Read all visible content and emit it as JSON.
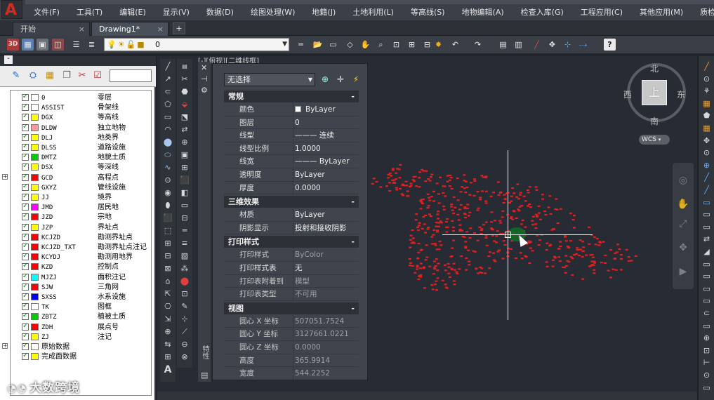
{
  "menu": [
    "文件(F)",
    "工具(T)",
    "编辑(E)",
    "显示(V)",
    "数据(D)",
    "绘图处理(W)",
    "地籍(J)",
    "土地利用(L)",
    "等高线(S)",
    "地物编辑(A)",
    "检查入库(G)",
    "工程应用(C)",
    "其他应用(M)",
    "质检模块(K)"
  ],
  "tabs": {
    "start": "开始",
    "drawing": "Drawing1*",
    "new": "+"
  },
  "toolbar": {
    "layer_value": "0",
    "view_3d": "3D"
  },
  "layer_tree": {
    "items": [
      {
        "code": "0",
        "desc": "零层",
        "color": "#ffffff"
      },
      {
        "code": "ASSIST",
        "desc": "骨架线",
        "color": "#ffffff"
      },
      {
        "code": "DGX",
        "desc": "等高线",
        "color": "#ffff00"
      },
      {
        "code": "DLDW",
        "desc": "独立地物",
        "color": "#ff9999"
      },
      {
        "code": "DLJ",
        "desc": "地类界",
        "color": "#ffff00"
      },
      {
        "code": "DLSS",
        "desc": "道路设施",
        "color": "#ffff00"
      },
      {
        "code": "DMTZ",
        "desc": "地貌土质",
        "color": "#00cc00"
      },
      {
        "code": "DSX",
        "desc": "等深线",
        "color": "#ffff00"
      },
      {
        "code": "GCD",
        "desc": "高程点",
        "color": "#ff0000",
        "expand": true
      },
      {
        "code": "GXYZ",
        "desc": "管线设施",
        "color": "#ffff00"
      },
      {
        "code": "JJ",
        "desc": "境界",
        "color": "#ffff00"
      },
      {
        "code": "JMD",
        "desc": "居民地",
        "color": "#ff00ff"
      },
      {
        "code": "JZD",
        "desc": "宗地",
        "color": "#ff0000"
      },
      {
        "code": "JZP",
        "desc": "界址点",
        "color": "#ffff00"
      },
      {
        "code": "KCJZD",
        "desc": "勘测界址点",
        "color": "#ff0000"
      },
      {
        "code": "KCJZD_TXT",
        "desc": "勘测界址点注记",
        "color": "#ff0000"
      },
      {
        "code": "KCYDJ",
        "desc": "勘测用地界",
        "color": "#ff0000"
      },
      {
        "code": "KZD",
        "desc": "控制点",
        "color": "#ff0000"
      },
      {
        "code": "MJZJ",
        "desc": "面积注记",
        "color": "#00ffff"
      },
      {
        "code": "SJW",
        "desc": "三角网",
        "color": "#ff0000"
      },
      {
        "code": "SXSS",
        "desc": "水系设施",
        "color": "#0000ff"
      },
      {
        "code": "TK",
        "desc": "图框",
        "color": "#ffffff"
      },
      {
        "code": "ZBTZ",
        "desc": "植被土质",
        "color": "#00cc00"
      },
      {
        "code": "ZDH",
        "desc": "展点号",
        "color": "#ff0000"
      },
      {
        "code": "ZJ",
        "desc": "注记",
        "color": "#ffff00"
      },
      {
        "code": "原始数据",
        "desc": "",
        "color": "#ffffff",
        "expand": true,
        "nocode": true
      },
      {
        "code": "完成面数据",
        "desc": "",
        "color": "#ffff00",
        "nocode": true
      }
    ]
  },
  "viewport": {
    "label": "[-][俯视][二维线框]"
  },
  "properties": {
    "selection": "无选择",
    "sections": [
      {
        "title": "常规",
        "rows": [
          {
            "k": "颜色",
            "v": "ByLayer"
          },
          {
            "k": "图层",
            "v": "0"
          },
          {
            "k": "线型",
            "v": "——— 连续"
          },
          {
            "k": "线型比例",
            "v": "1.0000"
          },
          {
            "k": "线宽",
            "v": "——— ByLayer"
          },
          {
            "k": "透明度",
            "v": "ByLayer"
          },
          {
            "k": "厚度",
            "v": "0.0000"
          }
        ]
      },
      {
        "title": "三维效果",
        "rows": [
          {
            "k": "材质",
            "v": "ByLayer"
          },
          {
            "k": "阴影显示",
            "v": "投射和接收阴影"
          }
        ]
      },
      {
        "title": "打印样式",
        "rows": [
          {
            "k": "打印样式",
            "v": "ByColor",
            "dim": true
          },
          {
            "k": "打印样式表",
            "v": "无"
          },
          {
            "k": "打印表附着到",
            "v": "模型",
            "dim": true
          },
          {
            "k": "打印表类型",
            "v": "不可用",
            "dim": true
          }
        ]
      },
      {
        "title": "视图",
        "rows": [
          {
            "k": "圆心 X 坐标",
            "v": "507051.7524",
            "dim": true
          },
          {
            "k": "圆心 Y 坐标",
            "v": "3127661.0221",
            "dim": true
          },
          {
            "k": "圆心 Z 坐标",
            "v": "0.0000",
            "dim": true
          },
          {
            "k": "高度",
            "v": "365.9914",
            "dim": true
          },
          {
            "k": "宽度",
            "v": "544.2252",
            "dim": true
          }
        ]
      }
    ],
    "minus": "-",
    "side_label": "特性"
  },
  "viewcube": {
    "north": "北",
    "south": "南",
    "east": "东",
    "west": "西",
    "top": "上",
    "wcs": "WCS"
  },
  "watermark": {
    "text": "大数跨境"
  },
  "colors": {
    "point": "#e02020",
    "canvas": "#262b34"
  }
}
